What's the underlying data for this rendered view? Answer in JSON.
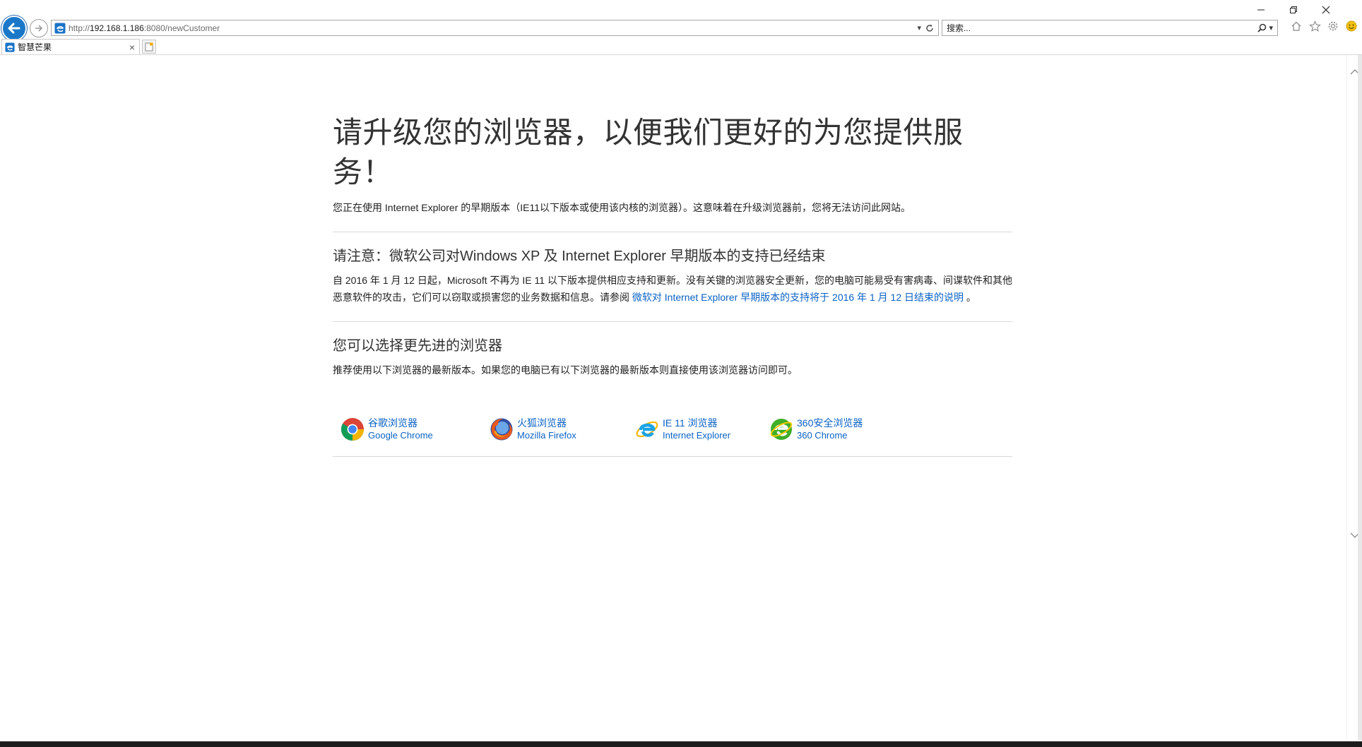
{
  "browser": {
    "url_prefix": "http://",
    "url_host": "192.168.1.186",
    "url_rest": ":8080/newCustomer",
    "search_placeholder": "搜索...",
    "tab_title": "智慧芒果"
  },
  "page": {
    "headline": "请升级您的浏览器，以便我们更好的为您提供服务！",
    "intro": "您正在使用 Internet Explorer 的早期版本（IE11以下版本或使用该内核的浏览器）。这意味着在升级浏览器前，您将无法访问此网站。",
    "notice_title": "请注意：微软公司对Windows XP 及 Internet Explorer 早期版本的支持已经结束",
    "notice_body": "自 2016 年 1 月 12 日起，Microsoft 不再为 IE 11 以下版本提供相应支持和更新。没有关键的浏览器安全更新，您的电脑可能易受有害病毒、间谍软件和其他恶意软件的攻击，它们可以窃取或损害您的业务数据和信息。请参阅",
    "notice_link": "微软对 Internet Explorer 早期版本的支持将于 2016 年 1 月 12 日结束的说明",
    "notice_end": "。",
    "choose_title": "您可以选择更先进的浏览器",
    "choose_body": "推荐使用以下浏览器的最新版本。如果您的电脑已有以下浏览器的最新版本则直接使用该浏览器访问即可。",
    "browsers": [
      {
        "name": "谷歌浏览器",
        "sub": "Google Chrome",
        "icon": "chrome-icon"
      },
      {
        "name": "火狐浏览器",
        "sub": "Mozilla Firefox",
        "icon": "firefox-icon"
      },
      {
        "name": "IE 11 浏览器",
        "sub": "Internet Explorer",
        "icon": "ie-icon"
      },
      {
        "name": "360安全浏览器",
        "sub": "360 Chrome",
        "icon": "360-icon"
      }
    ]
  },
  "colors": {
    "link": "#0b63c4",
    "back_button": "#1b78c9"
  }
}
